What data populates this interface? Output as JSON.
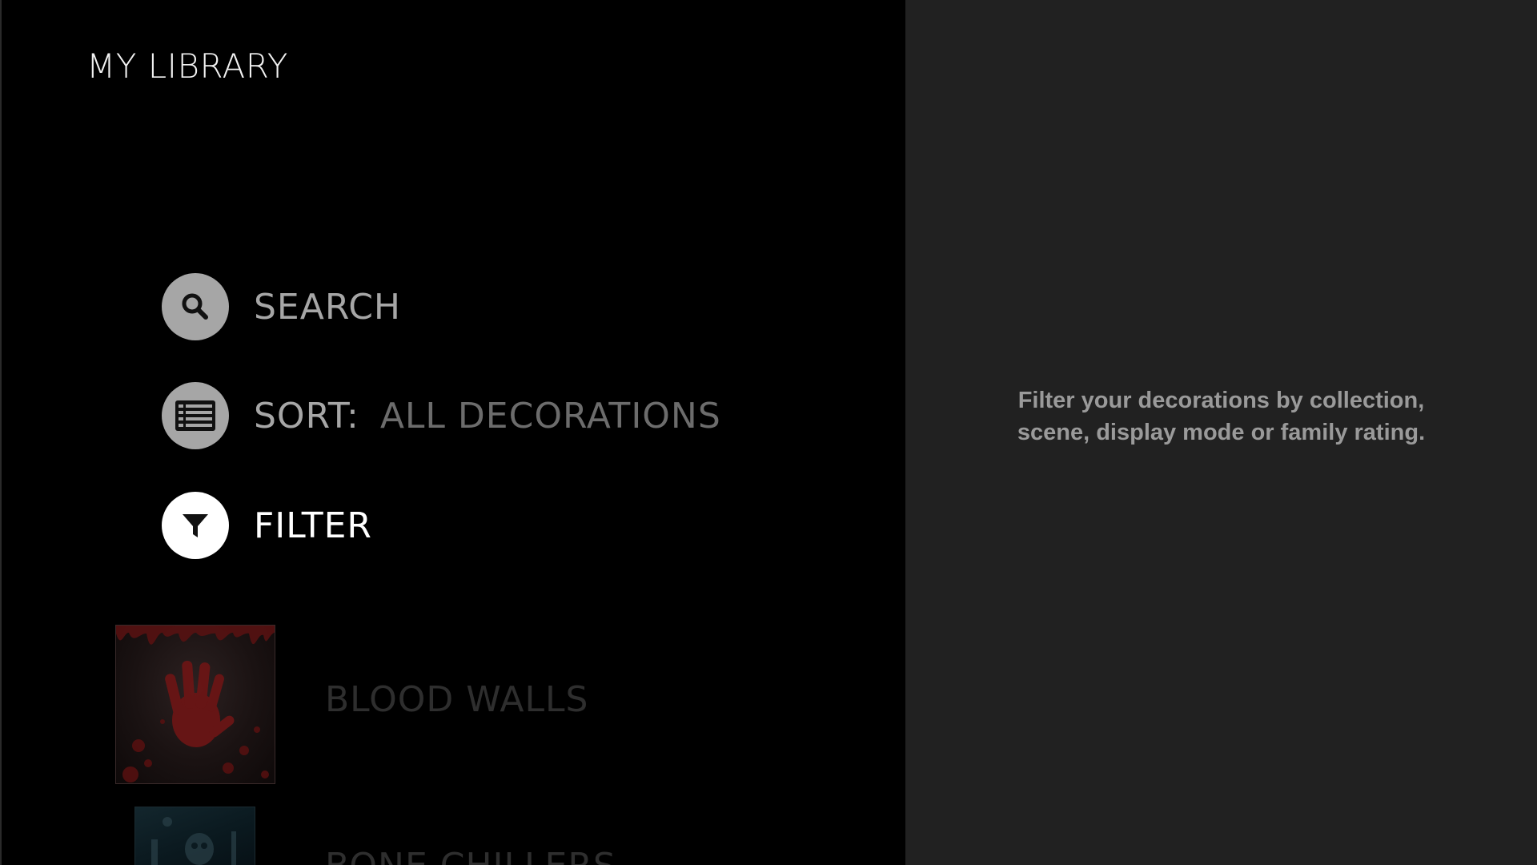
{
  "header": {
    "title": "MY LIBRARY"
  },
  "menu": {
    "search": {
      "label": "SEARCH",
      "icon": "search-icon"
    },
    "sort": {
      "label": "SORT:",
      "value": "ALL DECORATIONS",
      "icon": "list-icon"
    },
    "filter": {
      "label": "FILTER",
      "icon": "filter-icon",
      "selected": true
    }
  },
  "library_items": [
    {
      "title": "BLOOD WALLS"
    },
    {
      "title": "BONE CHILLERS"
    }
  ],
  "hint": {
    "line1": "Filter your decorations by collection,",
    "line2": "scene, display mode or family rating."
  },
  "colors": {
    "background": "#000000",
    "side_panel": "#212121",
    "icon_inactive": "#a6a6a6",
    "icon_active": "#ffffff",
    "muted_text": "#6c6c6c"
  }
}
